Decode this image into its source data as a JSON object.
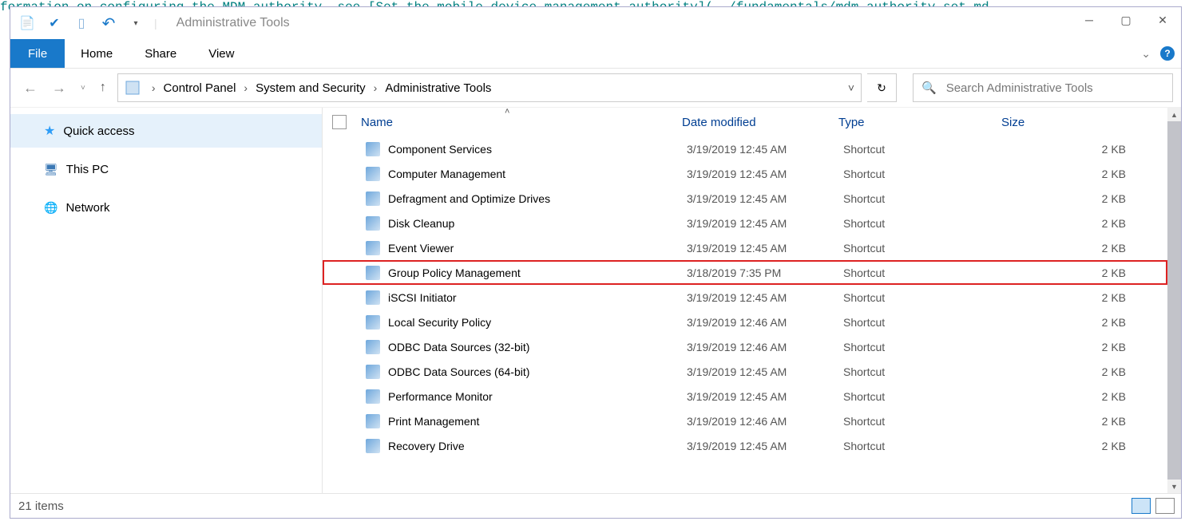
{
  "window_title": "Administrative Tools",
  "ribbon_tabs": {
    "file": "File",
    "home": "Home",
    "share": "Share",
    "view": "View"
  },
  "breadcrumb": [
    "Control Panel",
    "System and Security",
    "Administrative Tools"
  ],
  "search_placeholder": "Search Administrative Tools",
  "sidebar": [
    {
      "label": "Quick access",
      "icon": "star",
      "active": true
    },
    {
      "label": "This PC",
      "icon": "pc",
      "active": false
    },
    {
      "label": "Network",
      "icon": "net",
      "active": false
    }
  ],
  "columns": {
    "name": "Name",
    "date": "Date modified",
    "type": "Type",
    "size": "Size"
  },
  "files": [
    {
      "name": "Component Services",
      "date": "3/19/2019 12:45 AM",
      "type": "Shortcut",
      "size": "2 KB",
      "hl": false
    },
    {
      "name": "Computer Management",
      "date": "3/19/2019 12:45 AM",
      "type": "Shortcut",
      "size": "2 KB",
      "hl": false
    },
    {
      "name": "Defragment and Optimize Drives",
      "date": "3/19/2019 12:45 AM",
      "type": "Shortcut",
      "size": "2 KB",
      "hl": false
    },
    {
      "name": "Disk Cleanup",
      "date": "3/19/2019 12:45 AM",
      "type": "Shortcut",
      "size": "2 KB",
      "hl": false
    },
    {
      "name": "Event Viewer",
      "date": "3/19/2019 12:45 AM",
      "type": "Shortcut",
      "size": "2 KB",
      "hl": false
    },
    {
      "name": "Group Policy Management",
      "date": "3/18/2019 7:35 PM",
      "type": "Shortcut",
      "size": "2 KB",
      "hl": true
    },
    {
      "name": "iSCSI Initiator",
      "date": "3/19/2019 12:45 AM",
      "type": "Shortcut",
      "size": "2 KB",
      "hl": false
    },
    {
      "name": "Local Security Policy",
      "date": "3/19/2019 12:46 AM",
      "type": "Shortcut",
      "size": "2 KB",
      "hl": false
    },
    {
      "name": "ODBC Data Sources (32-bit)",
      "date": "3/19/2019 12:46 AM",
      "type": "Shortcut",
      "size": "2 KB",
      "hl": false
    },
    {
      "name": "ODBC Data Sources (64-bit)",
      "date": "3/19/2019 12:45 AM",
      "type": "Shortcut",
      "size": "2 KB",
      "hl": false
    },
    {
      "name": "Performance Monitor",
      "date": "3/19/2019 12:45 AM",
      "type": "Shortcut",
      "size": "2 KB",
      "hl": false
    },
    {
      "name": "Print Management",
      "date": "3/19/2019 12:46 AM",
      "type": "Shortcut",
      "size": "2 KB",
      "hl": false
    },
    {
      "name": "Recovery Drive",
      "date": "3/19/2019 12:45 AM",
      "type": "Shortcut",
      "size": "2 KB",
      "hl": false
    }
  ],
  "status": "21 items"
}
